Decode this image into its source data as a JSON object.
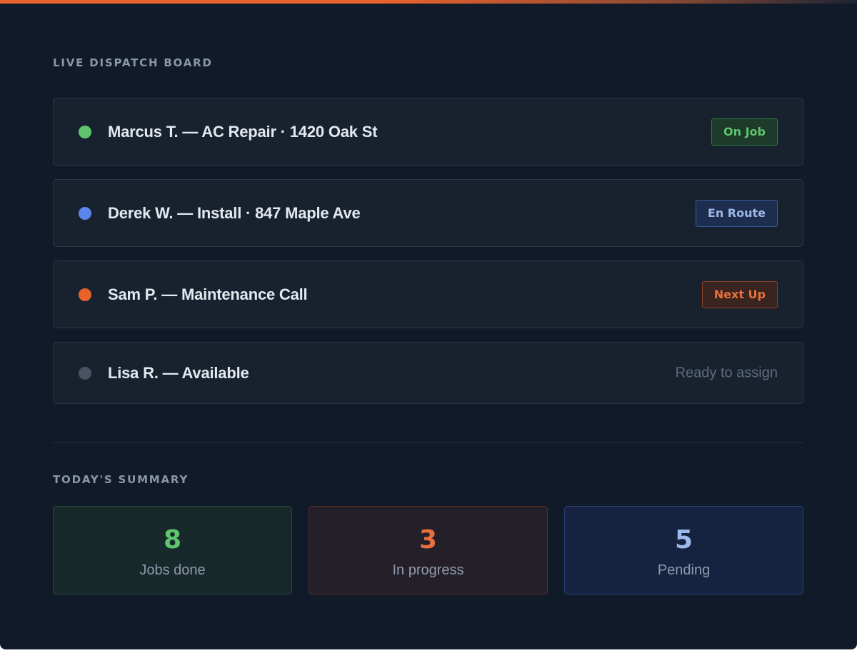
{
  "colors": {
    "background": "#101a29",
    "accent": "#e8622c",
    "green": "#5fc46c",
    "blue": "#5b87ea",
    "orange": "#e8622c",
    "gray": "#4a5362"
  },
  "dispatch": {
    "title": "LIVE DISPATCH BOARD",
    "rows": [
      {
        "label": "Marcus T. — AC Repair · 1420 Oak St",
        "dot_color": "#5fc46c",
        "badge": "On Job"
      },
      {
        "label": "Derek W. — Install · 847 Maple Ave",
        "dot_color": "#5b87ea",
        "badge": "En Route"
      },
      {
        "label": "Sam P. — Maintenance Call",
        "dot_color": "#e8622c",
        "badge": "Next Up"
      },
      {
        "label": "Lisa R. — Available",
        "dot_color": "#4a5362",
        "status": "Ready to assign"
      }
    ]
  },
  "summary": {
    "title": "TODAY'S SUMMARY",
    "stats": [
      {
        "value": "8",
        "label": "Jobs done",
        "color": "#5fc46c"
      },
      {
        "value": "3",
        "label": "In progress",
        "color": "#e8703f"
      },
      {
        "value": "5",
        "label": "Pending",
        "color": "#9db8ea"
      }
    ]
  }
}
